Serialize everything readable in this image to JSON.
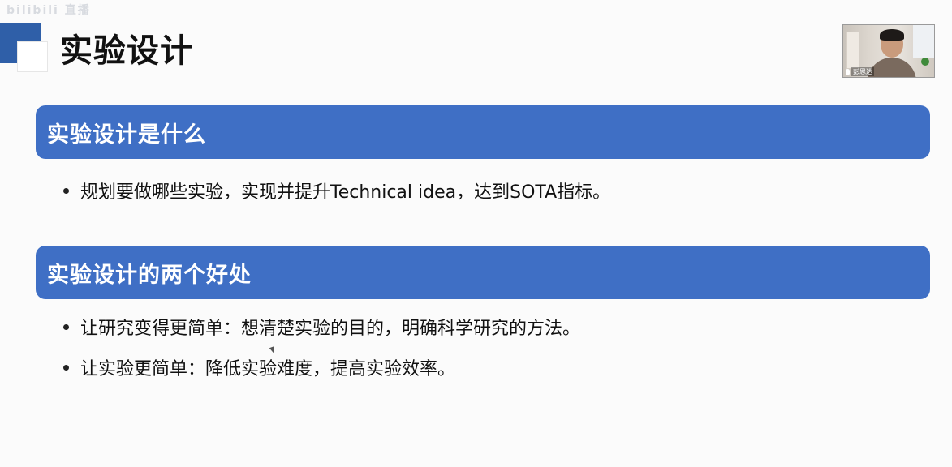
{
  "watermark": "bilibili 直播",
  "slide": {
    "title": "实验设计",
    "sections": [
      {
        "heading": "实验设计是什么",
        "bullets": [
          "规划要做哪些实验，实现并提升Technical idea，达到SOTA指标。"
        ]
      },
      {
        "heading": "实验设计的两个好处",
        "bullets": [
          "让研究变得更简单：想清楚实验的目的，明确科学研究的方法。",
          "让实验更简单：降低实验难度，提高实验效率。"
        ]
      }
    ]
  },
  "webcam": {
    "name": "彭思达",
    "icon": "mic-icon"
  },
  "colors": {
    "section_bar": "#3f6fc5",
    "deco_dark": "#2f5fa8",
    "background": "#fbfbfb"
  }
}
